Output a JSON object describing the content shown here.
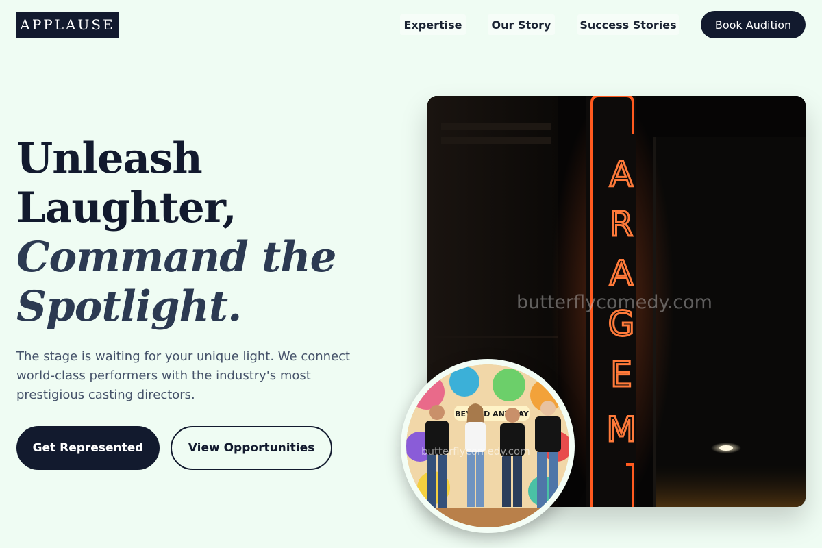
{
  "header": {
    "logo": "APPLAUSE",
    "nav": [
      {
        "label": "Expertise"
      },
      {
        "label": "Our Story"
      },
      {
        "label": "Success Stories"
      }
    ],
    "cta": "Book Audition"
  },
  "hero": {
    "title_line1": "Unleash",
    "title_line2": "Laughter,",
    "title_line3": "Command the",
    "title_line4": "Spotlight.",
    "description": "The stage is waiting for your unique light. We connect world-class performers with the industry's most prestigious casting directors.",
    "primary_button": "Get Represented",
    "secondary_button": "View Opportunities"
  },
  "images": {
    "main_watermark": "butterflycomedy.com",
    "neon_letters": [
      "A",
      "R",
      "A",
      "G",
      "E",
      "M"
    ],
    "circle_watermark": "butterflycomedy.com",
    "mural_text": "BEYOND ANYWAY"
  },
  "colors": {
    "background": "#effcf3",
    "primary": "#121a2e",
    "neon": "#ff5a1f"
  }
}
